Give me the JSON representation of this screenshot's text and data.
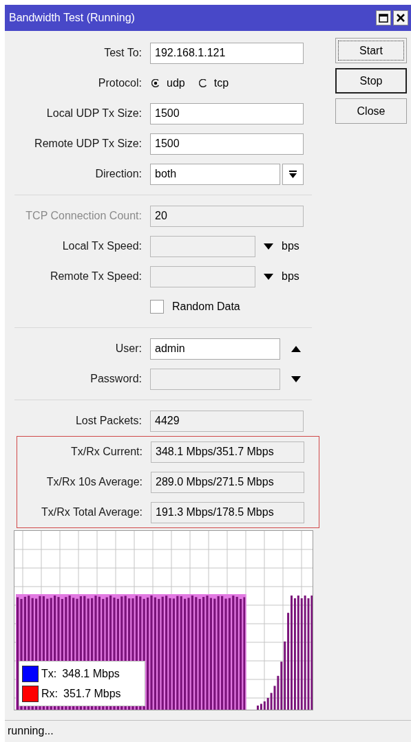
{
  "window": {
    "title": "Bandwidth Test (Running)"
  },
  "sections": [
    {
      "boxed": false,
      "rows": [
        {
          "kind": "text",
          "label": "Test To:",
          "value": "192.168.1.121",
          "dimmed": false,
          "editable": true
        },
        {
          "kind": "radio",
          "label": "Protocol:",
          "dimmed": false,
          "options": [
            {
              "label": "udp",
              "selected": true
            },
            {
              "label": "tcp",
              "selected": false
            }
          ]
        },
        {
          "kind": "text",
          "label": "Local UDP Tx Size:",
          "value": "1500",
          "dimmed": false,
          "editable": true
        },
        {
          "kind": "text",
          "label": "Remote UDP Tx Size:",
          "value": "1500",
          "dimmed": false,
          "editable": true
        },
        {
          "kind": "select",
          "label": "Direction:",
          "value": "both",
          "dimmed": false,
          "editable": true
        }
      ]
    },
    {
      "boxed": false,
      "rows": [
        {
          "kind": "text",
          "label": "TCP Connection Count:",
          "value": "20",
          "dimmed": true,
          "editable": false
        },
        {
          "kind": "speed",
          "label": "Local Tx Speed:",
          "unit": "bps",
          "dimmed": false,
          "editable": false
        },
        {
          "kind": "speed",
          "label": "Remote Tx Speed:",
          "unit": "bps",
          "dimmed": false,
          "editable": false
        },
        {
          "kind": "checkbox",
          "label": "Random Data",
          "checked": false
        }
      ]
    },
    {
      "boxed": false,
      "rows": [
        {
          "kind": "toggle",
          "label": "User:",
          "value": "admin",
          "dimmed": false,
          "editable": true,
          "expanded": true
        },
        {
          "kind": "toggle",
          "label": "Password:",
          "dimmed": false,
          "editable": false,
          "expanded": false
        }
      ]
    },
    {
      "boxed": false,
      "rows": [
        {
          "kind": "text",
          "label": "Lost Packets:",
          "value": "4429",
          "dimmed": false,
          "editable": false
        }
      ]
    },
    {
      "boxed": true,
      "rows": [
        {
          "kind": "text",
          "label": "Tx/Rx Current:",
          "value": "348.1 Mbps/351.7 Mbps",
          "dimmed": false,
          "editable": false
        },
        {
          "kind": "text",
          "label": "Tx/Rx 10s Average:",
          "value": "289.0 Mbps/271.5 Mbps",
          "dimmed": false,
          "editable": false
        },
        {
          "kind": "text",
          "label": "Tx/Rx Total Average:",
          "value": "191.3 Mbps/178.5 Mbps",
          "dimmed": false,
          "editable": false
        }
      ]
    }
  ],
  "buttons": [
    {
      "label": "Start",
      "focused": true,
      "default": false
    },
    {
      "label": "Stop",
      "focused": false,
      "default": true
    },
    {
      "label": "Close",
      "focused": false,
      "default": false
    }
  ],
  "graph": {
    "legend": [
      {
        "name": "Tx:",
        "value": "348.1 Mbps",
        "color": "#0000ff"
      },
      {
        "name": "Rx:",
        "value": "351.7 Mbps",
        "color": "#ff0000"
      }
    ]
  },
  "status_bar": {
    "text": "running..."
  }
}
